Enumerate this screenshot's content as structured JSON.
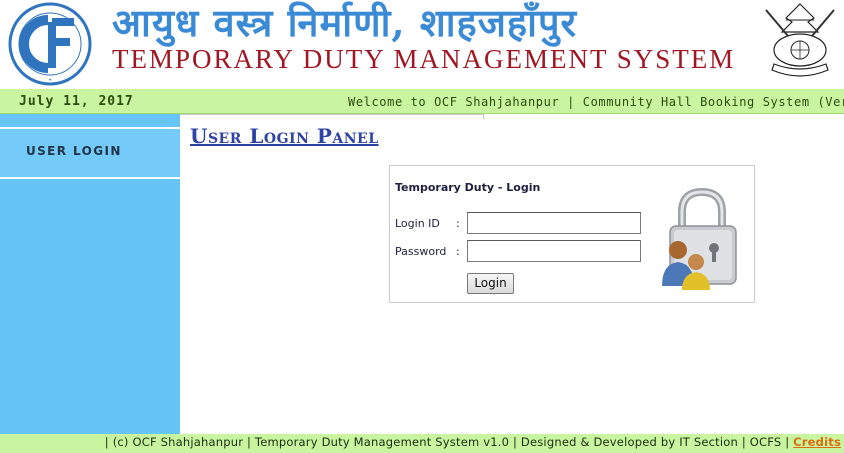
{
  "header": {
    "title_hindi": "आयुध वस्त्र निर्माणी, शाहजहाँपुर",
    "title_english": "TEMPORARY DUTY MANAGEMENT SYSTEM",
    "logo_text": "CF",
    "logo_icon": "ocf-logo-icon",
    "emblem_icon": "army-emblem-icon"
  },
  "infobar": {
    "date": "July 11, 2017",
    "ticker": "Welcome to OCF Shahjahanpur | Community Hall Booking System (Ver"
  },
  "sidebar": {
    "items": [
      {
        "label": "USER LOGIN"
      }
    ]
  },
  "main": {
    "panel_title": "User Login Panel",
    "login": {
      "title": "Temporary Duty - Login",
      "id_label": "Login ID",
      "password_label": "Password",
      "colon": ":",
      "id_value": "",
      "password_value": "",
      "button_label": "Login",
      "icon": "padlock-users-icon"
    }
  },
  "footer": {
    "text": "| (c) OCF Shahjahanpur | Temporary Duty Management System v1.0 | Designed & Developed by IT Section | OCFS | ",
    "credits_label": "Credits"
  },
  "colors": {
    "hindi_title": "#3a8ad6",
    "english_title": "#a01622",
    "infobar_bg": "#c9f5a0",
    "sidebar_bg": "#66c4f6",
    "panel_title": "#2f43a4",
    "credits_link": "#d96d10"
  }
}
